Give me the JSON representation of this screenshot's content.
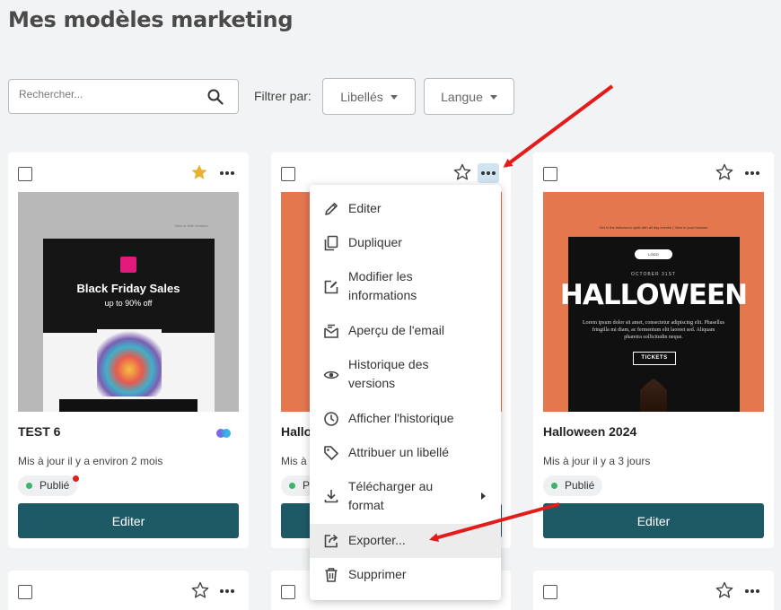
{
  "page": {
    "title": "Mes modèles marketing"
  },
  "search": {
    "placeholder": "Rechercher..."
  },
  "filters": {
    "label": "Filtrer par:",
    "labels_dropdown": "Libellés",
    "language_dropdown": "Langue"
  },
  "cards": [
    {
      "title": "TEST 6",
      "updated": "Mis à jour il y a environ 2 mois",
      "status": "Publié",
      "starred": true,
      "edit_label": "Editer",
      "thumbnail": {
        "logo": "Ode",
        "headline": "Black Friday Sales",
        "subline": "up to 90% off",
        "tiny": "View in Web browser"
      }
    },
    {
      "title": "Hallo",
      "updated": "Mis à",
      "status": "P",
      "starred": false,
      "edit_label": "E"
    },
    {
      "title": "Halloween 2024",
      "updated": "Mis à jour il y a 3 jours",
      "status": "Publié",
      "starred": false,
      "edit_label": "Editer",
      "thumbnail": {
        "topline": "Get in the halloween spirit with all day events! | View in your browser",
        "pill": "LOGO",
        "date": "OCTOBER 31ST",
        "headline": "HALLOWEEN",
        "body": "Lorem ipsum dolor sit amet, consectetur adipiscing elit. Phasellus fringilla mi diam, ac fermentum elit laoreet sed. Aliquam pharetra sollicitudin neque.",
        "button": "TICKETS"
      }
    }
  ],
  "context_menu": {
    "items": [
      {
        "label": "Editer",
        "icon": "pencil-icon"
      },
      {
        "label": "Dupliquer",
        "icon": "duplicate-icon"
      },
      {
        "label": "Modifier les\ninformations",
        "icon": "edit-info-icon"
      },
      {
        "label": "Aperçu de l'email",
        "icon": "email-preview-icon"
      },
      {
        "label": "Historique des\nversions",
        "icon": "eye-icon"
      },
      {
        "label": "Afficher l'historique",
        "icon": "history-icon"
      },
      {
        "label": "Attribuer un libellé",
        "icon": "tag-icon"
      },
      {
        "label": "Télécharger au\nformat",
        "icon": "download-icon"
      },
      {
        "label": "Exporter...",
        "icon": "export-icon"
      },
      {
        "label": "Supprimer",
        "icon": "trash-icon"
      }
    ]
  },
  "colors": {
    "primary_button": "#1e5a66",
    "star_active": "#e8b12f",
    "annotation_arrow": "#e31b1b",
    "published_dot": "#3cb26a"
  }
}
